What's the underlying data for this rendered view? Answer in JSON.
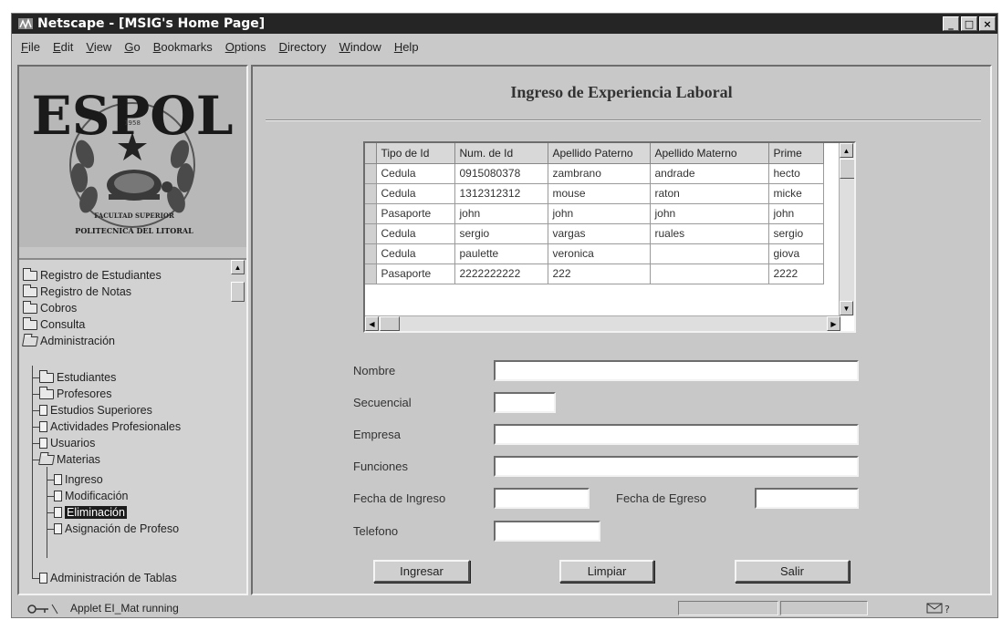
{
  "window": {
    "title": "Netscape - [MSIG's Home Page]",
    "controls": {
      "minimize": "_",
      "maximize": "□",
      "close": "×"
    }
  },
  "menu": [
    "File",
    "Edit",
    "View",
    "Go",
    "Bookmarks",
    "Options",
    "Directory",
    "Window",
    "Help"
  ],
  "logo": {
    "text": "ESPOL",
    "year": "1958",
    "motto": "FACULTAD SUPERIOR",
    "institution": "POLITECNICA DEL LITORAL"
  },
  "tree": {
    "items": [
      {
        "label": "Registro de Estudiantes",
        "icon": "folder-icon"
      },
      {
        "label": "Registro de Notas",
        "icon": "folder-icon"
      },
      {
        "label": "Cobros",
        "icon": "folder-icon"
      },
      {
        "label": "Consulta",
        "icon": "folder-icon"
      },
      {
        "label": "Administración",
        "icon": "folder-open-icon"
      },
      {
        "label": "Estudiantes",
        "icon": "folder-icon"
      },
      {
        "label": "Profesores",
        "icon": "folder-icon"
      },
      {
        "label": "Estudios Superiores",
        "icon": "document-icon"
      },
      {
        "label": "Actividades Profesionales",
        "icon": "document-icon"
      },
      {
        "label": "Usuarios",
        "icon": "document-icon"
      },
      {
        "label": "Materias",
        "icon": "folder-open-icon"
      },
      {
        "label": "Ingreso",
        "icon": "document-icon"
      },
      {
        "label": "Modificación",
        "icon": "document-icon"
      },
      {
        "label": "Eliminación",
        "icon": "document-icon",
        "selected": true
      },
      {
        "label": "Asignación de Profeso",
        "icon": "document-icon"
      },
      {
        "label": "Administración de Tablas",
        "icon": "document-icon"
      }
    ]
  },
  "form": {
    "title": "Ingreso de Experiencia Laboral",
    "table": {
      "columns": [
        "Tipo de Id",
        "Num. de Id",
        "Apellido Paterno",
        "Apellido Materno",
        "Prime"
      ],
      "rows": [
        [
          "Cedula",
          "0915080378",
          "zambrano",
          "andrade",
          "hecto"
        ],
        [
          "Cedula",
          "1312312312",
          "mouse",
          "raton",
          "micke"
        ],
        [
          "Pasaporte",
          "john",
          "john",
          "john",
          "john"
        ],
        [
          "Cedula",
          "sergio",
          "vargas",
          "ruales",
          "sergio"
        ],
        [
          "Cedula",
          "paulette",
          "veronica",
          "",
          "giova"
        ],
        [
          "Pasaporte",
          "2222222222",
          "222",
          "",
          "2222"
        ]
      ]
    },
    "labels": {
      "nombre": "Nombre",
      "secuencial": "Secuencial",
      "empresa": "Empresa",
      "funciones": "Funciones",
      "fecha_ingreso": "Fecha de Ingreso",
      "fecha_egreso": "Fecha de Egreso",
      "telefono": "Telefono"
    },
    "values": {
      "nombre": "",
      "secuencial": "",
      "empresa": "",
      "funciones": "",
      "fecha_ingreso": "",
      "fecha_egreso": "",
      "telefono": ""
    },
    "buttons": {
      "ingresar": "Ingresar",
      "limpiar": "Limpiar",
      "salir": "Salir"
    }
  },
  "status": {
    "text": "Applet EI_Mat running"
  }
}
